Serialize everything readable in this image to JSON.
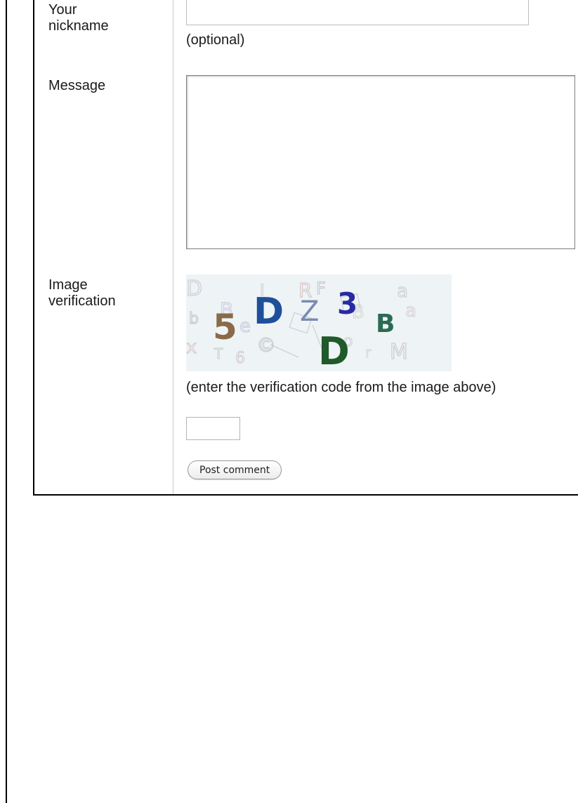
{
  "form": {
    "nickname": {
      "label": "Your nickname",
      "value": "",
      "hint": "(optional)"
    },
    "message": {
      "label": "Message",
      "value": ""
    },
    "verification": {
      "label": "Image verification",
      "captcha_glyphs": [
        "5",
        "D",
        "D",
        "Z",
        "3",
        "B"
      ],
      "hint": "(enter the verification code from the image above)",
      "value": ""
    },
    "submit_label": "Post comment"
  },
  "colors": {
    "border_dark": "#000000",
    "divider": "#c8c8c8",
    "captcha_background": "#eef4f5"
  }
}
